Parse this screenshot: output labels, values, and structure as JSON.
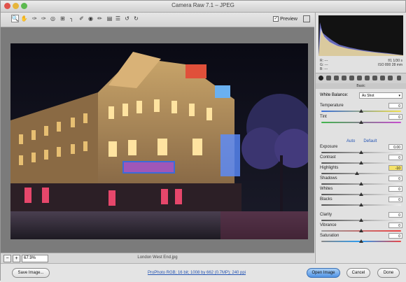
{
  "window": {
    "title": "Camera Raw 7.1  –  JPEG"
  },
  "toolbar": {
    "tools": [
      "zoom-icon",
      "hand-icon",
      "white-balance-icon",
      "color-sampler-icon",
      "targeted-adjustment-icon",
      "crop-icon",
      "straighten-icon",
      "spot-removal-icon",
      "red-eye-icon",
      "adjustment-brush-icon",
      "graduated-filter-icon",
      "preferences-icon",
      "rotate-ccw-icon",
      "rotate-cw-icon"
    ],
    "preview_label": "Preview"
  },
  "image": {
    "filename": "London West End.jpg"
  },
  "status": {
    "zoom": "67.9%"
  },
  "info": {
    "r_label": "R:",
    "g_label": "G:",
    "b_label": "B:",
    "r": "---",
    "g": "---",
    "b": "---",
    "exposure": "f/1   1/30 s",
    "iso": "ISO 800   28 mm"
  },
  "panel": {
    "section": "Basic",
    "white_balance_label": "White Balance:",
    "white_balance_value": "As Shot",
    "auto": "Auto",
    "default": "Default",
    "sliders": [
      {
        "name": "Temperature",
        "value": "0",
        "pos": 0.5,
        "colors": "temp"
      },
      {
        "name": "Tint",
        "value": "0",
        "pos": 0.5,
        "colors": "tint"
      },
      {
        "name": "Exposure",
        "value": "0.00",
        "pos": 0.5,
        "colors": "gray"
      },
      {
        "name": "Contrast",
        "value": "0",
        "pos": 0.5,
        "colors": "gray"
      },
      {
        "name": "Highlights",
        "value": "-10",
        "pos": 0.45,
        "colors": "gray",
        "highlight": true
      },
      {
        "name": "Shadows",
        "value": "0",
        "pos": 0.5,
        "colors": "gray"
      },
      {
        "name": "Whites",
        "value": "0",
        "pos": 0.5,
        "colors": "gray"
      },
      {
        "name": "Blacks",
        "value": "0",
        "pos": 0.5,
        "colors": "gray"
      },
      {
        "name": "Clarity",
        "value": "0",
        "pos": 0.5,
        "colors": "gray"
      },
      {
        "name": "Vibrance",
        "value": "0",
        "pos": 0.5,
        "colors": "vib"
      },
      {
        "name": "Saturation",
        "value": "0",
        "pos": 0.5,
        "colors": "sat"
      }
    ]
  },
  "bottom": {
    "save": "Save Image...",
    "workflow": "ProPhoto RGB; 16 bit; 1008 by 662 (0.7MP); 240 ppi",
    "open": "Open Image",
    "cancel": "Cancel",
    "done": "Done"
  },
  "colors": {
    "accent": "#4f92e4",
    "highlight_field": "#f6e36a"
  }
}
